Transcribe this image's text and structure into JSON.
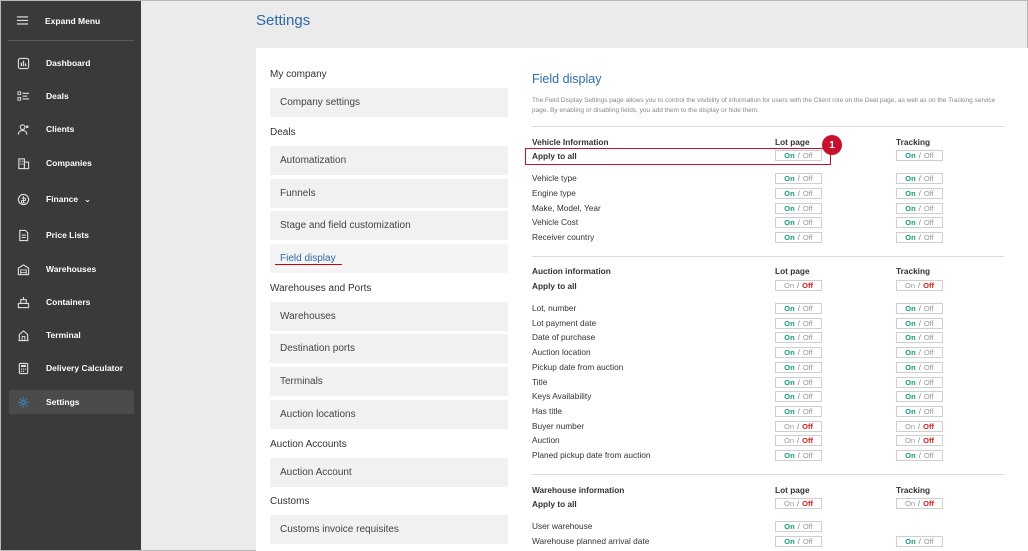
{
  "sidebar": {
    "expand_label": "Expand Menu",
    "items": [
      {
        "label": "Dashboard",
        "icon": "dashboard-icon"
      },
      {
        "label": "Deals",
        "icon": "deals-icon"
      },
      {
        "label": "Clients",
        "icon": "clients-icon"
      },
      {
        "label": "Companies",
        "icon": "companies-icon"
      },
      {
        "label": "Finance",
        "icon": "finance-icon"
      },
      {
        "label": "Price Lists",
        "icon": "price-lists-icon"
      },
      {
        "label": "Warehouses",
        "icon": "warehouses-icon"
      },
      {
        "label": "Containers",
        "icon": "containers-icon"
      },
      {
        "label": "Terminal",
        "icon": "terminal-icon"
      },
      {
        "label": "Delivery Calculator",
        "icon": "calculator-icon"
      },
      {
        "label": "Settings",
        "icon": "settings-icon"
      }
    ],
    "finance_chevron": "⌄"
  },
  "page": {
    "title": "Settings"
  },
  "menu": {
    "my_company": "My company",
    "company_settings": "Company settings",
    "deals": "Deals",
    "automatization": "Automatization",
    "funnels": "Funnels",
    "stage_customization": "Stage and field customization",
    "field_display": "Field display",
    "warehouses_ports": "Warehouses and Ports",
    "warehouses": "Warehouses",
    "destination_ports": "Destination ports",
    "terminals": "Terminals",
    "auction_locations": "Auction locations",
    "auction_accounts": "Auction Accounts",
    "auction_account": "Auction Account",
    "customs": "Customs",
    "customs_invoice": "Customs invoice requisites"
  },
  "field_display": {
    "title": "Field display",
    "description": "The Field Display Settings page allows you to control the visibility of information for users with the Client role on the Deal page, as well as on the Tracking service page. By enabling or disabling fields, you add them to the display or hide them.",
    "toggle_on": "On",
    "toggle_sep": "/",
    "toggle_off": "Off",
    "badge": "1",
    "sections": [
      {
        "header": "Vehicle Information",
        "col_lot": "Lot page",
        "col_tracking": "Tracking",
        "apply_label": "Apply to all",
        "apply_lot": "on",
        "apply_tracking": "on",
        "rows": [
          {
            "label": "Vehicle type",
            "lot": "on",
            "tracking": "on"
          },
          {
            "label": "Engine type",
            "lot": "on",
            "tracking": "on"
          },
          {
            "label": "Make, Model, Year",
            "lot": "on",
            "tracking": "on"
          },
          {
            "label": "Vehicle Cost",
            "lot": "on",
            "tracking": "on"
          },
          {
            "label": "Receiver country",
            "lot": "on",
            "tracking": "on"
          }
        ]
      },
      {
        "header": "Auction information",
        "col_lot": "Lot page",
        "col_tracking": "Tracking",
        "apply_label": "Apply to all",
        "apply_lot": "off",
        "apply_tracking": "off",
        "rows": [
          {
            "label": "Lot, number",
            "lot": "on",
            "tracking": "on"
          },
          {
            "label": "Lot payment date",
            "lot": "on",
            "tracking": "on"
          },
          {
            "label": "Date of purchase",
            "lot": "on",
            "tracking": "on"
          },
          {
            "label": "Auction location",
            "lot": "on",
            "tracking": "on"
          },
          {
            "label": "Pickup date from auction",
            "lot": "on",
            "tracking": "on"
          },
          {
            "label": "Title",
            "lot": "on",
            "tracking": "on"
          },
          {
            "label": "Keys Availability",
            "lot": "on",
            "tracking": "on"
          },
          {
            "label": "Has title",
            "lot": "on",
            "tracking": "on"
          },
          {
            "label": "Buyer number",
            "lot": "off",
            "tracking": "off"
          },
          {
            "label": "Auction",
            "lot": "off",
            "tracking": "off"
          },
          {
            "label": "Planed pickup date from auction",
            "lot": "on",
            "tracking": "on"
          }
        ]
      },
      {
        "header": "Warehouse information",
        "col_lot": "Lot page",
        "col_tracking": "Tracking",
        "apply_label": "Apply to all",
        "apply_lot": "off",
        "apply_tracking": "off",
        "rows": [
          {
            "label": "User warehouse",
            "lot": "on",
            "tracking": null
          },
          {
            "label": "Warehouse planned arrival date",
            "lot": "on",
            "tracking": "on"
          }
        ]
      }
    ]
  },
  "colors": {
    "accent": "#2d6aa8",
    "on": "#1a9a7a",
    "off": "#d21d1d",
    "sidebar": "#3a3a3a",
    "highlight": "#c8102e"
  }
}
